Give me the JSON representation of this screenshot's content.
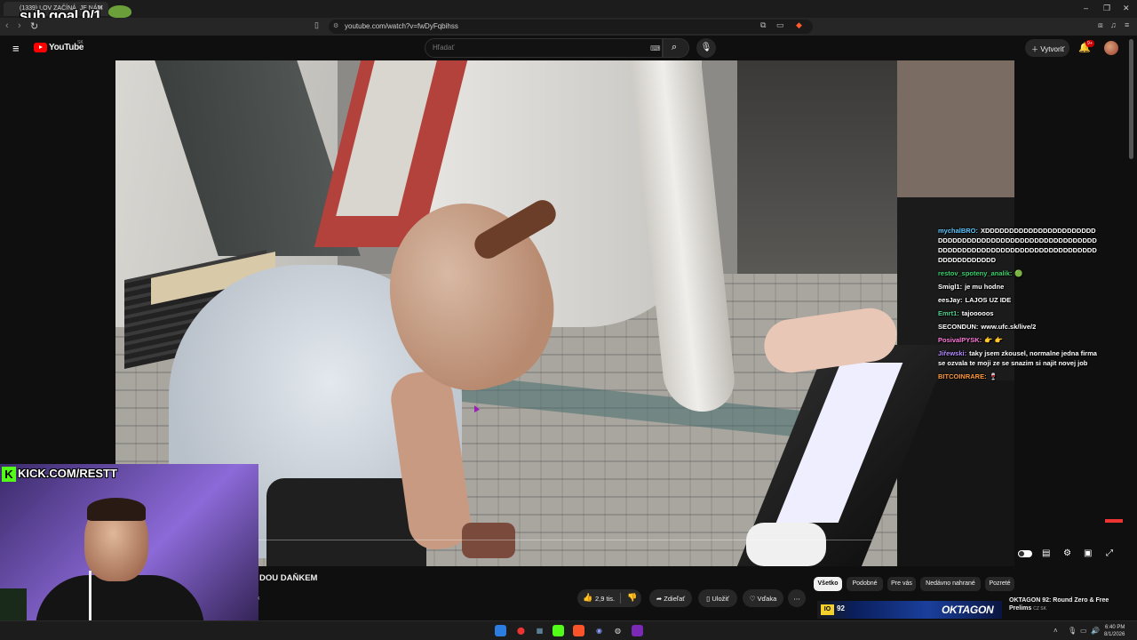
{
  "browser": {
    "tab_title": "(1339) LOV ZAČÍNÁ, JE NÁM",
    "overlay_text": "sub goal 0/1",
    "url": "youtube.com/watch?v=fwDyFqbihss",
    "window_controls": [
      "–",
      "❐",
      "✕"
    ]
  },
  "masthead": {
    "logo_text": "YouTube",
    "region": "SK",
    "search_placeholder": "Hľadať",
    "create_label": "Vytvoriť",
    "notification_count": "9+"
  },
  "chat": [
    {
      "user": "mychalBRO:",
      "color": "#5ec8ff",
      "text": "XDDDDDDDDDDDDDDDDDDDDDDDDDDDDDDDDDDDDDDDDDDDDDDDDDDDDDDDDDDDDDDDDDDDDDDDDDDDDDDDDDDDDDDDDDDDDDDDDDDDDD"
    },
    {
      "user": "restov_spoteny_analik:",
      "color": "#3ad36e",
      "text": "🟢"
    },
    {
      "user": "Smigl1:",
      "color": "#ffffff",
      "text": "je mu hodne"
    },
    {
      "user": "eesJay:",
      "color": "#ffffff",
      "text": "LAJOS UZ IDE"
    },
    {
      "user": "Emrt1:",
      "color": "#4fd18f",
      "text": "tajooooos"
    },
    {
      "user": "SECONDUN:",
      "color": "#ffffff",
      "text": "www.ufc.sk/live/2"
    },
    {
      "user": "PosivalPYSK:",
      "color": "#ff7ad9",
      "text": "👉 👉"
    },
    {
      "user": "Jiřewski:",
      "color": "#b58cff",
      "text": "taky jsem zkousel, normalne jedna firma se ozvala te moji ze se snazim si najit novej job"
    },
    {
      "user": "BITCOINRARE:",
      "color": "#ff9a3c",
      "text": "🍷"
    }
  ],
  "webcam": {
    "kick_text": "KICK.COM/RESTT"
  },
  "video": {
    "title_partial": "DOU DAŇKEM",
    "like_count": "2,9 tis.",
    "share_label": "Zdieľať",
    "save_label": "Uložiť",
    "thanks_label": "Vďaka",
    "more_label": "⋯"
  },
  "chips": [
    "Všetko",
    "Podobné",
    "Pre vás",
    "Nedávno nahrané",
    "Pozreté"
  ],
  "recommendation": {
    "io_label": "IO",
    "number": "92",
    "brand": "OKTAGON",
    "title": "OKTAGON 92: Round Zero & Free Prelims",
    "channel": "CZ SK"
  },
  "taskbar": {
    "time": "6:40 PM",
    "date": "8/1/2026"
  }
}
